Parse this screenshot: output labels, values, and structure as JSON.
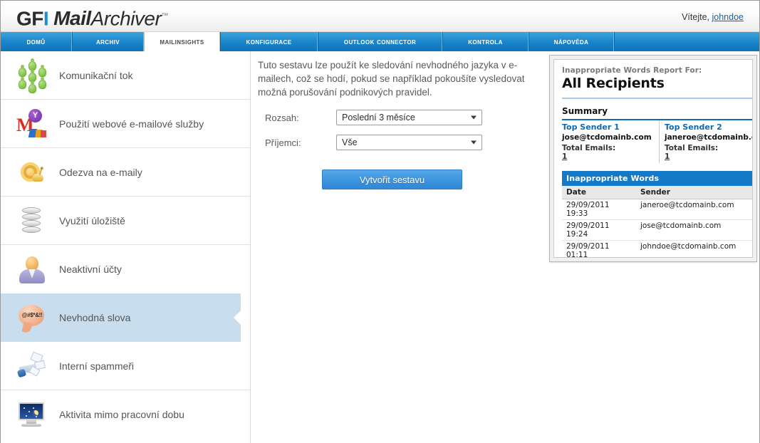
{
  "header": {
    "logo_gf": "GF",
    "logo_i": "I",
    "logo_mail": "Mail",
    "logo_archiver": "Archiver",
    "trademark": "™",
    "welcome_text": "Vítejte,",
    "username": "johndoe"
  },
  "tabs": [
    {
      "label": "Domů",
      "active": false
    },
    {
      "label": "Archiv",
      "active": false
    },
    {
      "label": "MailInsights",
      "active": true
    },
    {
      "label": "Konfigurace",
      "active": false
    },
    {
      "label": "Outlook Connector",
      "active": false
    },
    {
      "label": "Kontrola",
      "active": false
    },
    {
      "label": "Nápověda",
      "active": false
    }
  ],
  "sidebar": {
    "items": [
      {
        "label": "Komunikační tok",
        "icon": "network-people-icon",
        "selected": false
      },
      {
        "label": "Použití webové e-mailové služby",
        "icon": "webmail-icon",
        "selected": false
      },
      {
        "label": "Odezva na e-maily",
        "icon": "snail-icon",
        "selected": false
      },
      {
        "label": "Využití úložiště",
        "icon": "database-icon",
        "selected": false
      },
      {
        "label": "Neaktivní účty",
        "icon": "user-icon",
        "selected": false
      },
      {
        "label": "Nevhodná slova",
        "icon": "speech-bubble-icon",
        "selected": true
      },
      {
        "label": "Interní spammeři",
        "icon": "megaphone-icon",
        "selected": false
      },
      {
        "label": "Aktivita mimo pracovní dobu",
        "icon": "night-monitor-icon",
        "selected": false
      }
    ]
  },
  "main": {
    "description": "Tuto sestavu lze použít ke sledování nevhodného jazyka v e-mailech, což se hodí, pokud se například pokoušíte vysledovat možná porušování podnikových pravidel.",
    "fields": [
      {
        "label": "Rozsah:",
        "value": "Poslední 3 měsíce"
      },
      {
        "label": "Příjemci:",
        "value": "Vše"
      }
    ],
    "generate_button": "Vytvořit sestavu"
  },
  "preview": {
    "subtitle": "Inappropriate Words Report For:",
    "title": "All Recipients",
    "summary_label": "Summary",
    "senders": [
      {
        "heading": "Top Sender 1",
        "email": "jose@tcdomainb.com",
        "metric_label": "Total Emails:",
        "metric_value": "1"
      },
      {
        "heading": "Top Sender 2",
        "email": "janeroe@tcdomainb.com",
        "metric_label": "Total Emails:",
        "metric_value": "1"
      }
    ],
    "table_title": "Inappropriate Words",
    "columns": [
      "Date",
      "Sender"
    ],
    "rows": [
      [
        "29/09/2011 19:33",
        "janeroe@tcdomainb.com"
      ],
      [
        "29/09/2011 19:24",
        "jose@tcdomainb.com"
      ],
      [
        "29/09/2011 01:11",
        "johndoe@tcdomainb.com"
      ]
    ]
  },
  "colors": {
    "brand_blue": "#1a86cc",
    "accent_blue": "#1479c6",
    "selected_row": "#c8dded",
    "link": "#1f5f9e"
  }
}
